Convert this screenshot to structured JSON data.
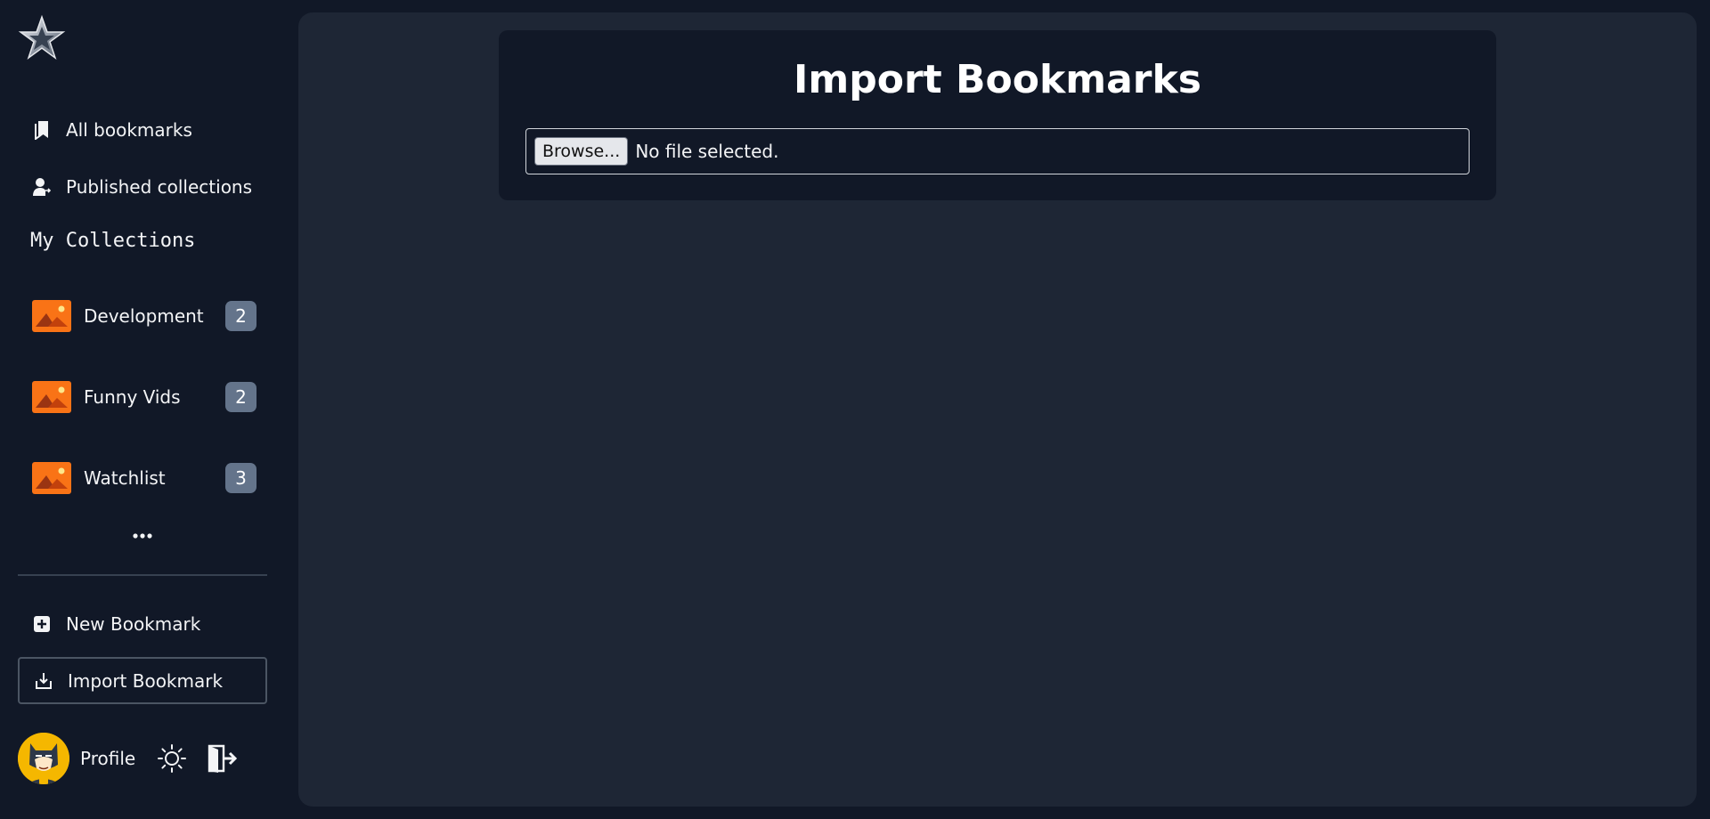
{
  "sidebar": {
    "logo": "star-logo",
    "nav": {
      "all_bookmarks": "All bookmarks",
      "published_collections": "Published collections"
    },
    "section_title": "My Collections",
    "collections": [
      {
        "name": "Development",
        "count": "2"
      },
      {
        "name": "Funny Vids",
        "count": "2"
      },
      {
        "name": "Watchlist",
        "count": "3"
      }
    ],
    "more": "•••",
    "actions": {
      "new_bookmark": "New Bookmark",
      "import_bookmark": "Import Bookmark"
    },
    "footer": {
      "profile_label": "Profile"
    }
  },
  "main": {
    "title": "Import Bookmarks",
    "file_input": {
      "button_label": "Browse...",
      "status": "No file selected."
    }
  },
  "colors": {
    "sidebar_bg": "#111827",
    "main_bg": "#1e2635",
    "card_bg": "#111827",
    "collection_thumb": "#f97316",
    "badge_bg": "#64748b"
  }
}
